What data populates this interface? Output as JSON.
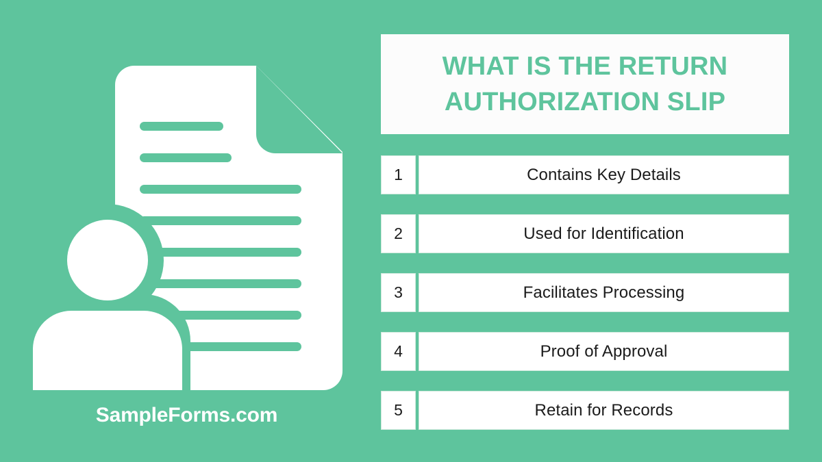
{
  "theme": {
    "background_green": "#5EC49D",
    "card_white": "#FCFCFC",
    "box_white": "#FFFFFF",
    "text_dark": "#1B1B1B",
    "brand_white": "#FFFFFF"
  },
  "header": {
    "title": "WHAT IS THE RETURN AUTHORIZATION SLIP"
  },
  "illustration": {
    "name": "document-with-person-icon",
    "description": "White document with folded top-right corner, green text lines, and a person silhouette at lower left"
  },
  "brand": {
    "text": "SampleForms.com"
  },
  "list": {
    "items": [
      {
        "number": "1",
        "label": "Contains Key Details"
      },
      {
        "number": "2",
        "label": "Used for Identification"
      },
      {
        "number": "3",
        "label": "Facilitates Processing"
      },
      {
        "number": "4",
        "label": "Proof of Approval"
      },
      {
        "number": "5",
        "label": "Retain for Records"
      }
    ]
  }
}
